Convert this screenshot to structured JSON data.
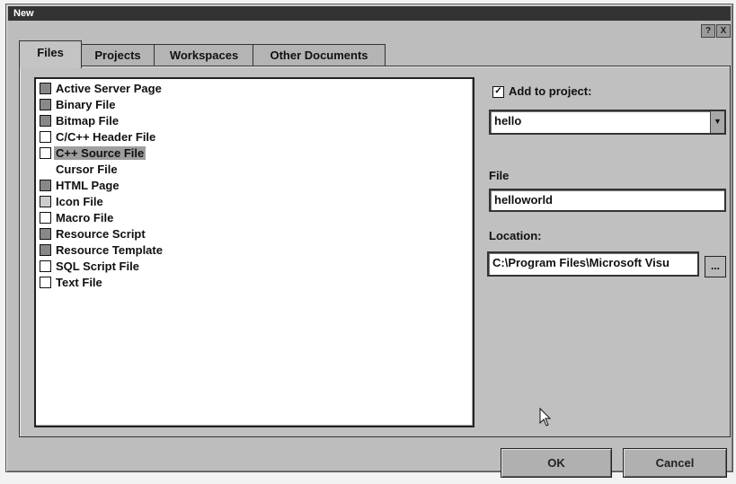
{
  "window": {
    "title": "New",
    "help_btn": "?",
    "close_btn": "X"
  },
  "tabs": [
    "Files",
    "Projects",
    "Workspaces",
    "Other Documents"
  ],
  "files": [
    "Active Server Page",
    "Binary File",
    "Bitmap File",
    "C/C++ Header File",
    "C++ Source File",
    "Cursor File",
    "HTML Page",
    "Icon File",
    "Macro File",
    "Resource Script",
    "Resource Template",
    "SQL Script File",
    "Text File"
  ],
  "selected_file": "C++ Source File",
  "add_to_project": {
    "label": "Add to project:",
    "checked": true,
    "check_mark": "✓",
    "value": "hello",
    "dropdown_glyph": "▼"
  },
  "file_field": {
    "label": "File",
    "value": "helloworld"
  },
  "location_field": {
    "label": "Location:",
    "value": "C:\\Program Files\\Microsoft Visu",
    "browse_label": "..."
  },
  "buttons": {
    "ok": "OK",
    "cancel": "Cancel"
  }
}
